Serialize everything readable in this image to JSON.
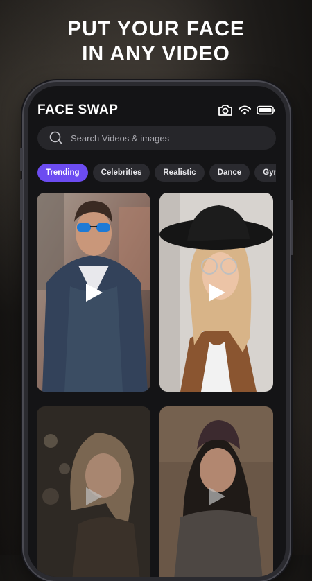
{
  "headline": {
    "line1": "PUT YOUR FACE",
    "line2": "IN ANY VIDEO"
  },
  "app": {
    "title": "FACE SWAP"
  },
  "status_icons": [
    "camera-icon",
    "wifi-icon",
    "battery-icon"
  ],
  "search": {
    "placeholder": "Search Videos & images"
  },
  "categories": [
    "Trending",
    "Celebrities",
    "Realistic",
    "Dance",
    "Gym"
  ],
  "active_category": "Trending",
  "videos": [
    {
      "subject": "man-sunglasses"
    },
    {
      "subject": "woman-hat-glasses"
    },
    {
      "subject": "woman-wavy-hair"
    },
    {
      "subject": "woman-beanie"
    }
  ],
  "colors": {
    "accent": "#6c4cf1",
    "screen_bg": "#141416",
    "chip_bg": "#2a2a2f"
  }
}
